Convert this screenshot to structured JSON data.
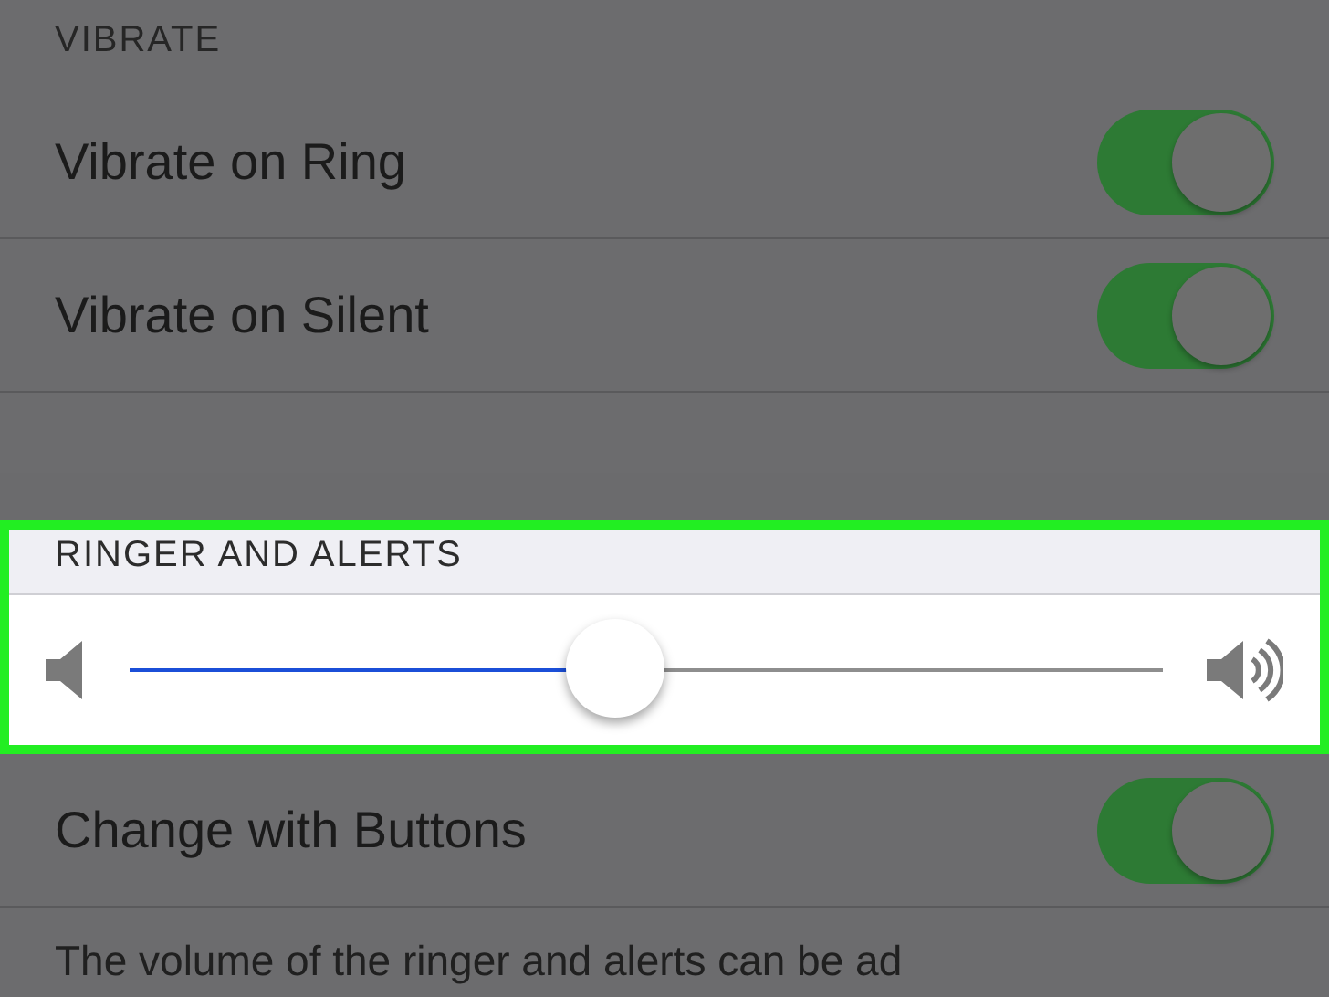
{
  "sections": [
    {
      "header": "VIBRATE",
      "highlighted": false,
      "rows": [
        {
          "kind": "toggle",
          "label": "Vibrate on Ring",
          "on": true
        },
        {
          "kind": "toggle",
          "label": "Vibrate on Silent",
          "on": true
        }
      ]
    },
    {
      "header": "RINGER AND ALERTS",
      "highlighted": true,
      "rows": [
        {
          "kind": "slider",
          "level": 0.47
        }
      ]
    },
    {
      "highlighted": false,
      "rows": [
        {
          "kind": "toggle",
          "label": "Change with Buttons",
          "on": true
        }
      ],
      "footer": "The volume of the ringer and alerts can be ad"
    }
  ]
}
